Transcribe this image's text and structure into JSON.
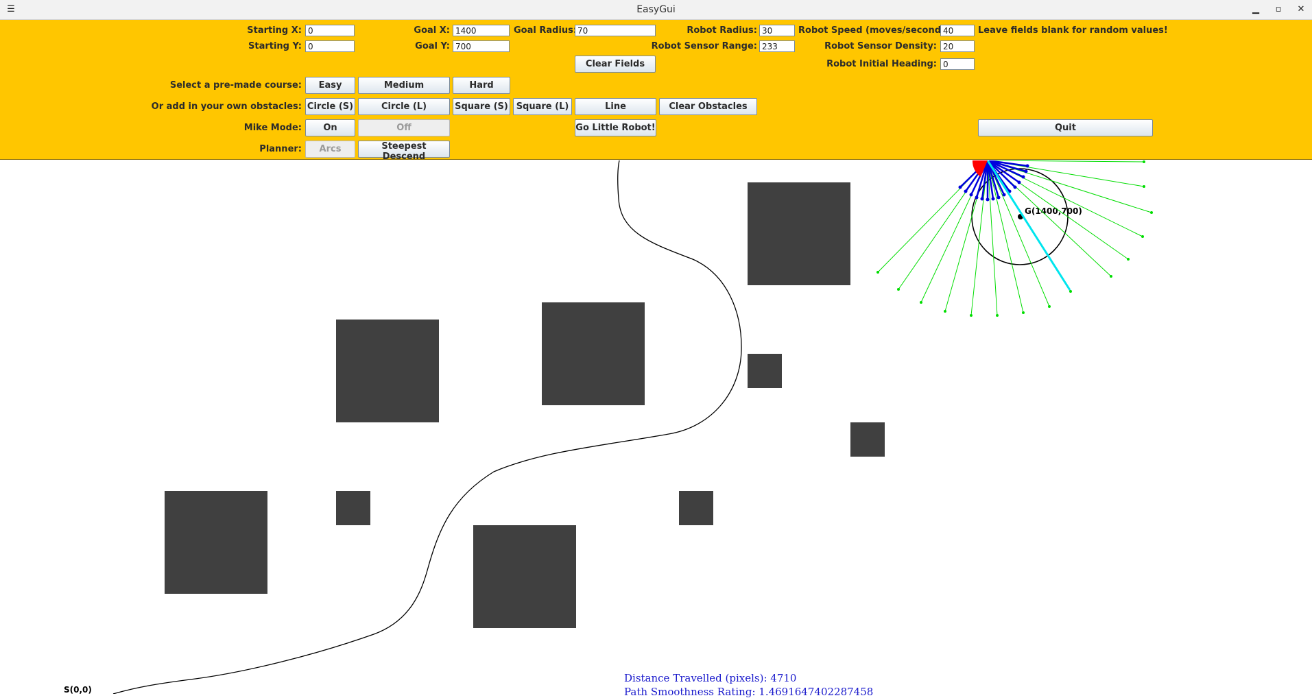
{
  "window": {
    "title": "EasyGui",
    "menu_icon": "hamburger-menu-icon",
    "minimize_icon": "minimize-icon",
    "maximize_icon": "maximize-icon",
    "close_icon": "close-icon"
  },
  "form": {
    "starting_x_label": "Starting X:",
    "starting_x_value": "0",
    "starting_y_label": "Starting Y:",
    "starting_y_value": "0",
    "goal_x_label": "Goal X:",
    "goal_x_value": "1400",
    "goal_y_label": "Goal Y:",
    "goal_y_value": "700",
    "goal_radius_label": "Goal Radius:",
    "goal_radius_value": "70",
    "robot_radius_label": "Robot Radius:",
    "robot_radius_value": "30",
    "robot_sensor_range_label": "Robot Sensor Range:",
    "robot_sensor_range_value": "233",
    "robot_speed_label": "Robot Speed (moves/second):",
    "robot_speed_value": "40",
    "robot_sensor_density_label": "Robot Sensor Density:",
    "robot_sensor_density_value": "20",
    "robot_initial_heading_label": "Robot Initial Heading:",
    "robot_initial_heading_value": "0",
    "hint": "Leave fields blank for random values!",
    "clear_fields": "Clear Fields"
  },
  "course": {
    "label": "Select a pre-made course:",
    "easy": "Easy",
    "medium": "Medium",
    "hard": "Hard"
  },
  "obstacles": {
    "label": "Or add in your own obstacles:",
    "circle_s": "Circle (S)",
    "circle_l": "Circle (L)",
    "square_s": "Square (S)",
    "square_l": "Square (L)",
    "line": "Line",
    "clear": "Clear Obstacles"
  },
  "mike_mode": {
    "label": "Mike Mode:",
    "on": "On",
    "off": "Off",
    "on_enabled": true,
    "off_enabled": false
  },
  "go_button": "Go Little Robot!",
  "quit_button": "Quit",
  "planner": {
    "label": "Planner:",
    "arcs": "Arcs",
    "steepest": "Steepest Descend",
    "arcs_enabled": false
  },
  "scene": {
    "start_label": "S(0,0)",
    "goal_label": "G(1400,700)",
    "colors": {
      "panel": "#ffc600",
      "obstacle": "#404040",
      "path": "#000000",
      "robot": "#ff0000",
      "sensor_short": "#0000dd",
      "sensor_long": "#00dd00",
      "heading": "#00e5ee",
      "stats_text": "#1a1acc"
    }
  },
  "stats": {
    "distance_label": "Distance Travelled (pixels):",
    "distance_value": "4710",
    "smoothness_label": "Path Smoothness Rating:",
    "smoothness_value": "1.4691647402287458"
  }
}
